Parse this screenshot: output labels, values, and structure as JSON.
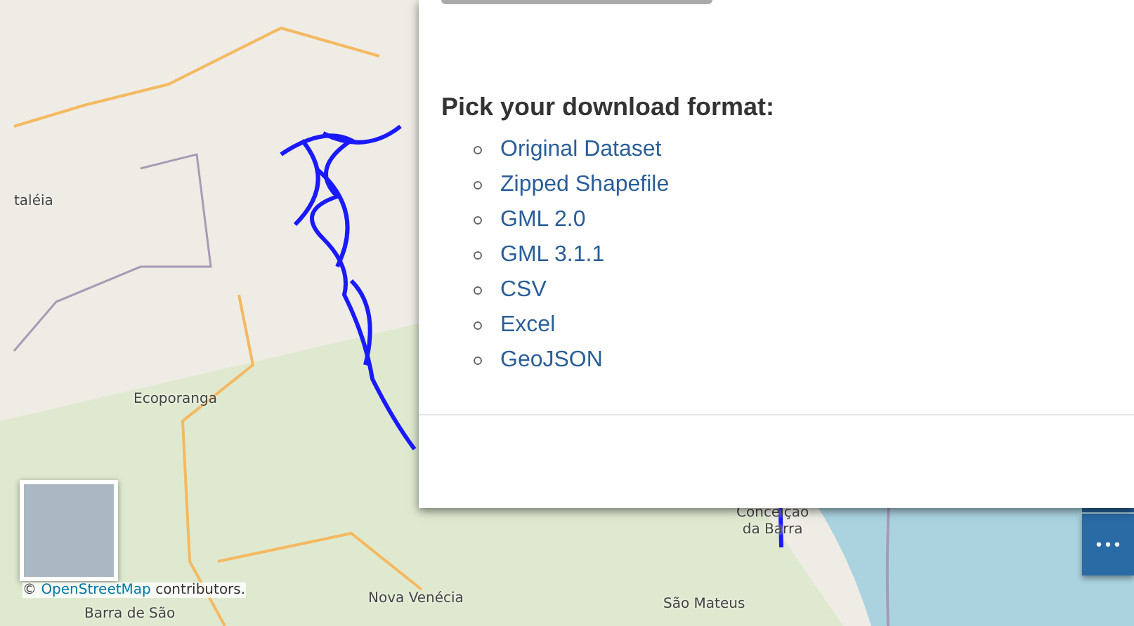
{
  "map": {
    "labels": [
      {
        "text": "taléia"
      },
      {
        "text": "Ecoporanga"
      },
      {
        "text": "Nova Venécia"
      },
      {
        "text": "Barra de São"
      },
      {
        "text": "Conceição\nda Barra"
      },
      {
        "text": "São Mateus"
      }
    ],
    "attribution": {
      "symbol": "©",
      "link": "OpenStreetMap",
      "text": "contributors."
    },
    "menu_button": {
      "label": "•••"
    }
  },
  "dialog": {
    "heading": "Pick your download format:",
    "formats": [
      "Original Dataset",
      "Zipped Shapefile",
      "GML 2.0",
      "GML 3.1.1",
      "CSV",
      "Excel",
      "GeoJSON"
    ]
  }
}
